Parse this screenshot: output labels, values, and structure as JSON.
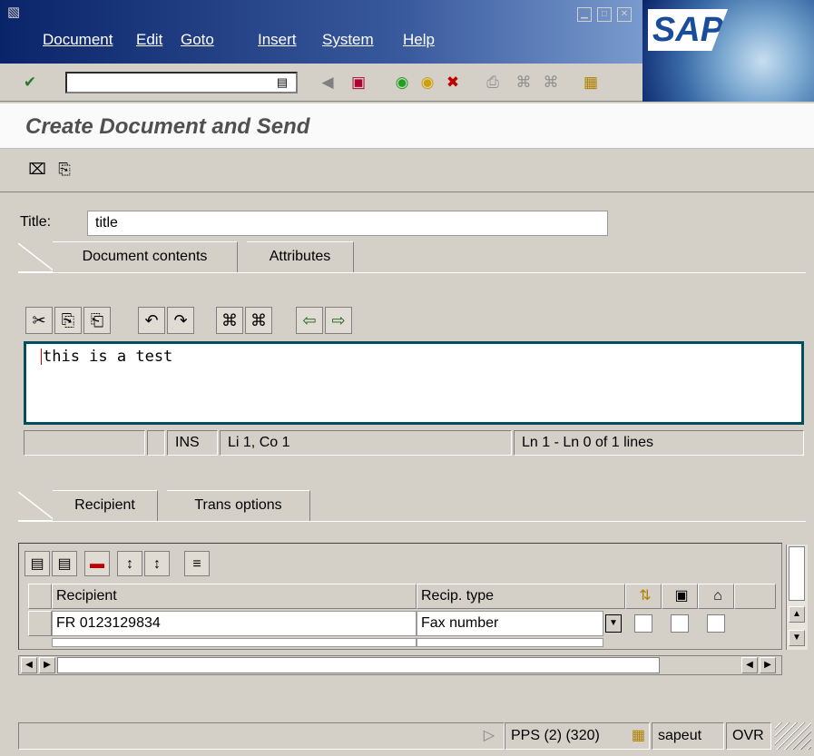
{
  "menu": {
    "items": [
      "Document",
      "Edit",
      "Goto",
      "Insert",
      "System",
      "Help"
    ]
  },
  "logo_text": "SAP",
  "screen_title": "Create Document and Send",
  "form": {
    "title_label": "Title:",
    "title_value": "title"
  },
  "doc_tabs": [
    {
      "label": "Document contents",
      "active": true
    },
    {
      "label": "Attributes",
      "active": false
    }
  ],
  "editor": {
    "text": "this is a test",
    "status": {
      "mode": "INS",
      "position": "Li 1, Co 1",
      "lines": "Ln 1 - Ln 0 of 1 lines"
    }
  },
  "recipient_tabs": [
    {
      "label": "Recipient",
      "active": true
    },
    {
      "label": "Trans options",
      "active": false
    }
  ],
  "recipient_table": {
    "headers": [
      "Recipient",
      "Recip. type"
    ],
    "rows": [
      {
        "recipient": "FR 0123129834",
        "type": "Fax number"
      }
    ]
  },
  "status_bar": {
    "system": "PPS (2) (320)",
    "server": "sapeut",
    "mode": "OVR"
  },
  "colors": {
    "title_bar": "#0a246a",
    "editor_border": "#004e5e",
    "caret": "#cc0000"
  }
}
